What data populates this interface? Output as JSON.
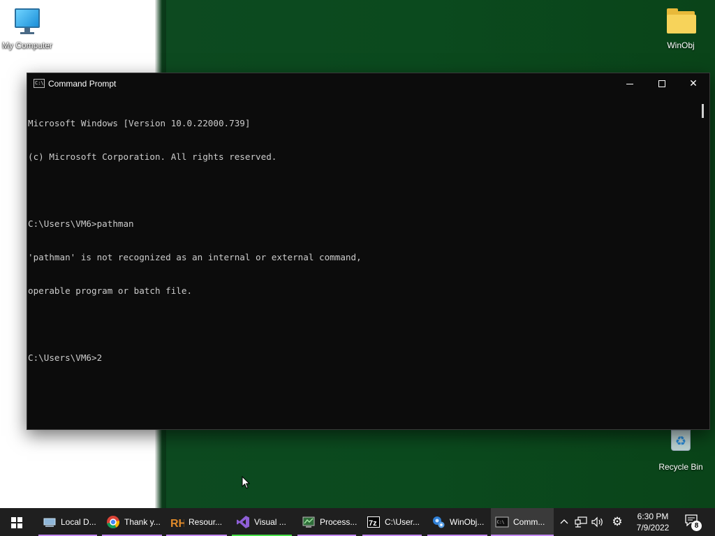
{
  "desktop": {
    "icons": [
      {
        "label": "My Computer",
        "icon": "computer-icon"
      },
      {
        "label": "WinObj",
        "icon": "folder-icon"
      },
      {
        "label": "Recycle Bin",
        "icon": "recycle-bin-icon"
      }
    ]
  },
  "cmd": {
    "title": "Command Prompt",
    "icon": "console-icon",
    "lines": [
      "Microsoft Windows [Version 10.0.22000.739]",
      "(c) Microsoft Corporation. All rights reserved.",
      "",
      "C:\\Users\\VM6>pathman",
      "'pathman' is not recognized as an internal or external command,",
      "operable program or batch file.",
      "",
      "C:\\Users\\VM6>2"
    ]
  },
  "taskbar": {
    "start_icon": "windows-logo-icon",
    "items": [
      {
        "label": "Local D...",
        "icon": "drive-icon",
        "color": "#c58af9"
      },
      {
        "label": "Thank y...",
        "icon": "chrome-icon",
        "color": "#c58af9"
      },
      {
        "label": "Resour...",
        "icon": "resource-hacker-icon",
        "color": "#c58af9"
      },
      {
        "label": "Visual ...",
        "icon": "visual-studio-icon",
        "color": "#49e04a"
      },
      {
        "label": "Process...",
        "icon": "process-monitor-icon",
        "color": "#c58af9"
      },
      {
        "label": "C:\\User...",
        "icon": "7zip-icon",
        "color": "#c58af9"
      },
      {
        "label": "WinObj...",
        "icon": "winobj-icon",
        "color": "#c58af9"
      },
      {
        "label": "Comm...",
        "icon": "console-icon",
        "color": "#c58af9",
        "active": true
      }
    ],
    "tray_icons": [
      "chevron-up-icon",
      "network-icon",
      "volume-icon",
      "settings-icon"
    ],
    "clock": {
      "time": "6:30 PM",
      "date": "7/9/2022"
    },
    "notifications": {
      "count": "8",
      "icon": "notification-icon"
    }
  }
}
